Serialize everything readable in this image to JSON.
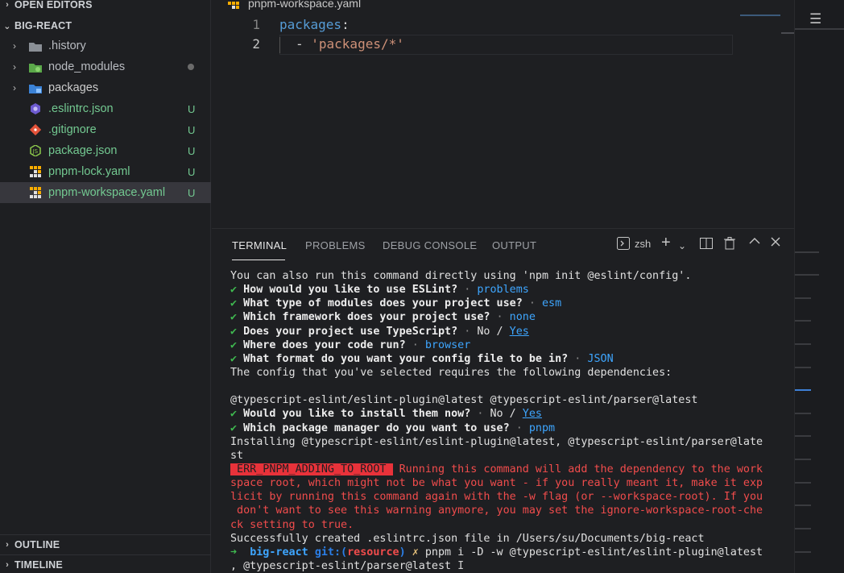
{
  "sidebar": {
    "open_editors_label": "OPEN EDITORS",
    "project_label": "BIG-REACT",
    "items": [
      {
        "name": ".history",
        "status": ""
      },
      {
        "name": "node_modules",
        "status": ""
      },
      {
        "name": "packages",
        "status": ""
      },
      {
        "name": ".eslintrc.json",
        "status": "U"
      },
      {
        "name": ".gitignore",
        "status": "U"
      },
      {
        "name": "package.json",
        "status": "U"
      },
      {
        "name": "pnpm-lock.yaml",
        "status": "U"
      },
      {
        "name": "pnpm-workspace.yaml",
        "status": "U"
      }
    ],
    "outline_label": "OUTLINE",
    "timeline_label": "TIMELINE"
  },
  "editor": {
    "tab_title": "pnpm-workspace.yaml",
    "lines": [
      {
        "number": "1",
        "key": "packages",
        "punct": ":"
      },
      {
        "number": "2",
        "dash": "- ",
        "value": "'packages/*'"
      }
    ]
  },
  "panel": {
    "tabs": [
      "TERMINAL",
      "PROBLEMS",
      "DEBUG CONSOLE",
      "OUTPUT"
    ],
    "shell": "zsh"
  },
  "terminal": {
    "l1": "You can also run this command directly using 'npm init @eslint/config'.",
    "check": "✔",
    "sep": " · ",
    "q1": "How would you like to use ESLint?",
    "a1": "problems",
    "q2": "What type of modules does your project use?",
    "a2": "esm",
    "q3": "Which framework does your project use?",
    "a3": "none",
    "q4": "Does your project use TypeScript?",
    "a4_no": "No / ",
    "a4_yes": "Yes",
    "q5": "Where does your code run?",
    "a5": "browser",
    "q6": "What format do you want your config file to be in?",
    "a6": "JSON",
    "l8": "The config that you've selected requires the following dependencies:",
    "l10": "@typescript-eslint/eslint-plugin@latest @typescript-eslint/parser@latest",
    "q7": "Would you like to install them now?",
    "a7_no": "No / ",
    "a7_yes": "Yes",
    "q8": "Which package manager do you want to use?",
    "a8": "pnpm",
    "l13": "Installing @typescript-eslint/eslint-plugin@latest, @typescript-eslint/parser@late",
    "l14": "st",
    "err_code": " ERR_PNPM_ADDING_TO_ROOT ",
    "err1": " Running this command will add the dependency to the work",
    "err2": "space root, which might not be what you want - if you really meant it, make it exp",
    "err3": "licit by running this command again with the -w flag (or --workspace-root). If you",
    "err4": " don't want to see this warning anymore, you may set the ignore-workspace-root-che",
    "err5": "ck setting to true.",
    "l20": "Successfully created .eslintrc.json file in /Users/su/Documents/big-react",
    "prompt_arrow": "➜",
    "prompt_dir": "big-react",
    "prompt_git": "git:(",
    "prompt_branch": "resource",
    "prompt_close": ")",
    "prompt_x": "✗",
    "cmd": "pnpm i -D -w @typescript-eslint/eslint-plugin@latest",
    "cmd2": ", @typescript-eslint/parser@latest "
  },
  "colors": {
    "untracked": "#73c991",
    "accent": "#3ea6ff",
    "error": "#f14c4c"
  }
}
